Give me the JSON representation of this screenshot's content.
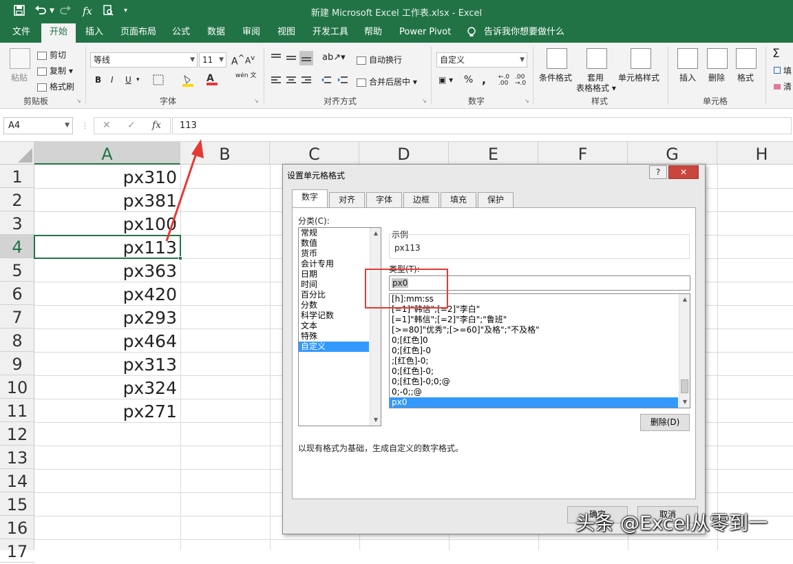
{
  "window": {
    "title": "新建 Microsoft Excel 工作表.xlsx  -  Excel"
  },
  "qat": {
    "save_icon": "save-icon",
    "undo_icon": "undo-icon",
    "redo_icon": "redo-icon",
    "fx_icon": "fx-icon",
    "preview_icon": "print-preview-icon"
  },
  "tabs": [
    "文件",
    "开始",
    "插入",
    "页面布局",
    "公式",
    "数据",
    "审阅",
    "视图",
    "开发工具",
    "帮助",
    "Power Pivot",
    "告诉我你想要做什么"
  ],
  "ribbon": {
    "clipboard": {
      "paste": "粘贴",
      "cut": "剪切",
      "copy": "复制",
      "format_painter": "格式刷",
      "label": "剪贴板"
    },
    "font": {
      "name": "等线",
      "size": "11",
      "bold": "B",
      "italic": "I",
      "underline": "U",
      "wen": "wén 文",
      "label": "字体"
    },
    "alignment": {
      "wrap": "自动换行",
      "merge": "合并后居中",
      "label": "对齐方式"
    },
    "number": {
      "format": "自定义",
      "percent": "%",
      "comma": ",",
      "label": "数字"
    },
    "styles": {
      "conditional": "条件格式",
      "table1": "套用",
      "table2": "表格格式",
      "cell_styles": "单元格样式",
      "label": "样式"
    },
    "cells": {
      "insert": "插入",
      "delete": "删除",
      "format": "格式",
      "label": "单元格"
    },
    "editing": {
      "sum": "Σ",
      "fill": "填",
      "clear": "清"
    }
  },
  "formula_bar": {
    "name_box": "A4",
    "cancel": "✕",
    "enter": "✓",
    "fx": "fx",
    "value": "113"
  },
  "sheet": {
    "columns": [
      "A",
      "B",
      "C",
      "D",
      "E",
      "F",
      "G",
      "H"
    ],
    "rows": [
      "1",
      "2",
      "3",
      "4",
      "5",
      "6",
      "7",
      "8",
      "9",
      "10",
      "11",
      "12",
      "13",
      "14",
      "15",
      "16",
      "17"
    ],
    "cells_A": [
      "px310",
      "px381",
      "px100",
      "px113",
      "px363",
      "px420",
      "px293",
      "px464",
      "px313",
      "px324",
      "px271"
    ],
    "selected": "A4"
  },
  "dialog": {
    "title": "设置单元格格式",
    "help": "?",
    "close": "✕",
    "tabs": [
      "数字",
      "对齐",
      "字体",
      "边框",
      "填充",
      "保护"
    ],
    "category_label": "分类(C):",
    "categories": [
      "常规",
      "数值",
      "货币",
      "会计专用",
      "日期",
      "时间",
      "百分比",
      "分数",
      "科学记数",
      "文本",
      "特殊",
      "自定义"
    ],
    "selected_category": "自定义",
    "sample_label": "示例",
    "sample_value": "px113",
    "type_label": "类型(T):",
    "type_value": "px0",
    "type_list": [
      "[h]:mm:ss",
      "[=1]\"韩信\";[=2]\"李白\"",
      "[=1]\"韩信\";[=2]\"李白\";\"鲁班\"",
      "[>=80]\"优秀\";[>=60]\"及格\";\"不及格\"",
      "0;[红色]0",
      "0;[红色]-0",
      ";[红色]-0;",
      "0;[红色]-0;",
      "0;[红色]-0;0;@",
      "0;-0;;@",
      "px0"
    ],
    "selected_type": "px0",
    "delete_button": "删除(D)",
    "description": "以现有格式为基础，生成自定义的数字格式。",
    "ok": "确定",
    "cancel": "取消"
  },
  "watermark": "头条 @Excel从零到一",
  "colors": {
    "excel_green": "#217346",
    "annotation_red": "#e53935",
    "selection_blue": "#3399ff"
  }
}
